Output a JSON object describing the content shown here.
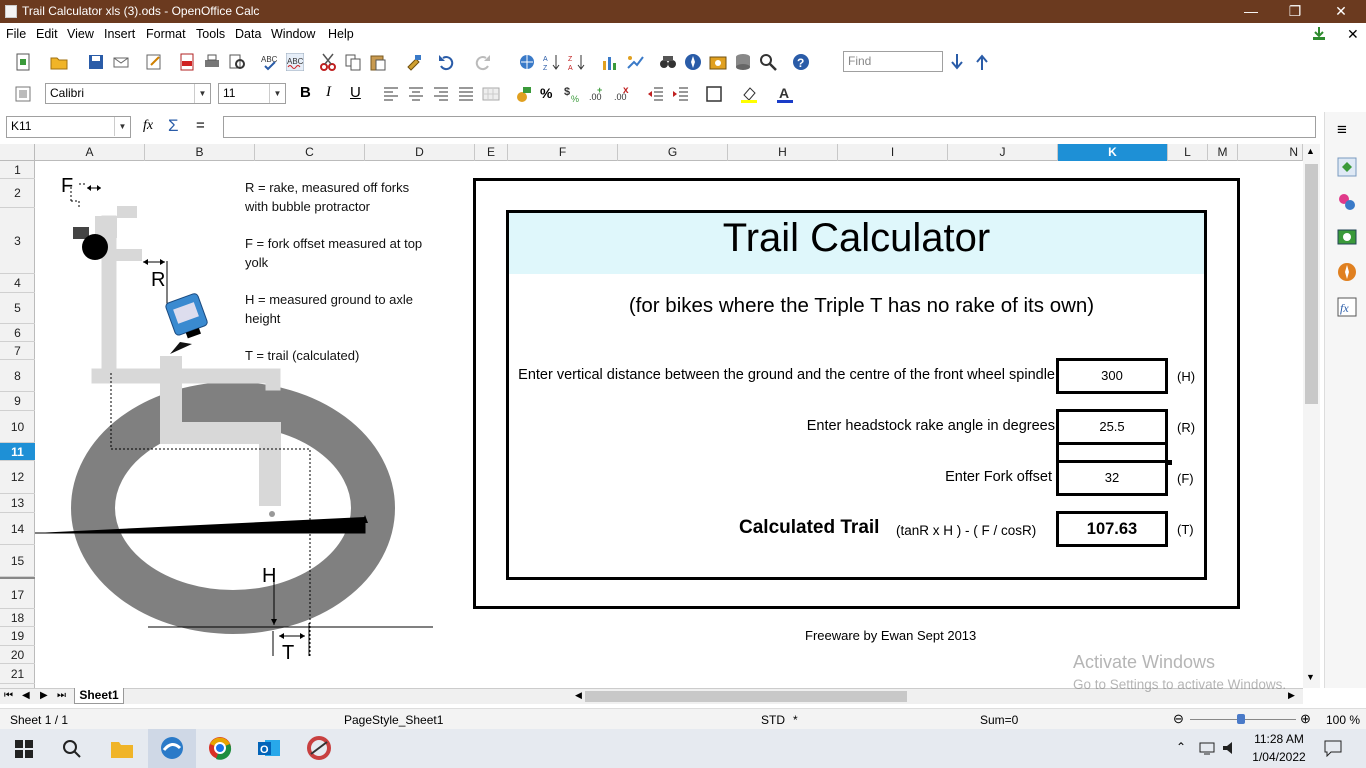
{
  "window": {
    "title": "Trail Calculator  xls (3).ods - OpenOffice Calc",
    "controls": [
      "—",
      "❐",
      "✕"
    ]
  },
  "menu": [
    "File",
    "Edit",
    "View",
    "Insert",
    "Format",
    "Tools",
    "Data",
    "Window",
    "Help"
  ],
  "toolbar": {
    "find_placeholder": "Find",
    "font_name": "Calibri",
    "font_size": "11"
  },
  "formula_bar": {
    "name_box": "K11",
    "content": ""
  },
  "columns": [
    "A",
    "B",
    "C",
    "D",
    "E",
    "F",
    "G",
    "H",
    "I",
    "J",
    "K",
    "L",
    "M",
    "N"
  ],
  "selected_column": "K",
  "rows": [
    "1",
    "2",
    "3",
    "4",
    "5",
    "6",
    "7",
    "8",
    "9",
    "10",
    "11",
    "12",
    "13",
    "14",
    "15",
    "17",
    "18",
    "19",
    "20",
    "21"
  ],
  "selected_row": "11",
  "diagram": {
    "labels": {
      "f": "F",
      "r": "R",
      "h": "H",
      "t": "T"
    }
  },
  "notes": {
    "r": "R = rake, measured off forks with bubble protractor",
    "f": "F = fork offset measured at top yolk",
    "h": "H = measured ground to axle height",
    "t": "T = trail (calculated)"
  },
  "calculator": {
    "title": "Trail Calculator",
    "subtitle": "(for bikes where the Triple T has no rake of its own)",
    "inputs": [
      {
        "label": "Enter vertical distance between the ground and the centre of the front wheel spindle",
        "value": "300",
        "unit": "(H)"
      },
      {
        "label": "Enter headstock rake angle in degrees",
        "value": "25.5",
        "unit": "(R)"
      },
      {
        "label": "Enter Fork offset",
        "value": "32",
        "unit": "(F)"
      }
    ],
    "result": {
      "label": "Calculated Trail",
      "formula": "(tanR  x H ) - ( F / cosR)",
      "value": "107.63",
      "unit": "(T)"
    },
    "credit": "Freeware by Ewan Sept 2013"
  },
  "sheet_tabs": [
    "Sheet1"
  ],
  "status": {
    "sheet": "Sheet 1 / 1",
    "page_style": "PageStyle_Sheet1",
    "mode": "STD",
    "modified": "*",
    "sum": "Sum=0",
    "zoom": "100 %"
  },
  "watermark": {
    "line1": "Activate Windows",
    "line2": "Go to Settings to activate Windows."
  },
  "taskbar": {
    "time": "11:28 AM",
    "date": "1/04/2022"
  },
  "colors": {
    "titlebar": "#6b3a1f",
    "selection": "#1e90d6",
    "title_band": "#dff7fb"
  }
}
